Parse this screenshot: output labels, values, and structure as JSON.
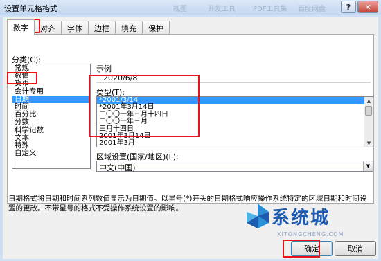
{
  "window": {
    "title": "设置单元格格式",
    "help": "?",
    "close": "✕",
    "ghost_labels": [
      "视图",
      "开发工具",
      "PDF工具集",
      "百度网盘"
    ]
  },
  "tabs": [
    {
      "label": "数字",
      "active": true
    },
    {
      "label": "对齐",
      "active": false
    },
    {
      "label": "字体",
      "active": false
    },
    {
      "label": "边框",
      "active": false
    },
    {
      "label": "填充",
      "active": false
    },
    {
      "label": "保护",
      "active": false
    }
  ],
  "category": {
    "label": "分类(C):",
    "items": [
      "常规",
      "数值",
      "货币",
      "会计专用",
      "日期",
      "时间",
      "百分比",
      "分数",
      "科学记数",
      "文本",
      "特殊",
      "自定义"
    ],
    "selected_index": 4
  },
  "sample": {
    "legend": "示例",
    "value": "2020/6/8"
  },
  "type": {
    "label": "类型(T):",
    "items": [
      "*2001/3/14",
      "*2001年3月14日",
      "二〇〇一年三月十四日",
      "二〇〇一年三月",
      "三月十四日",
      "2001年3月14日",
      "2001年3月"
    ],
    "selected_index": 0
  },
  "locale": {
    "label": "区域设置(国家/地区)(L):",
    "value": "中文(中国)"
  },
  "description": "日期格式将日期和时间系列数值显示为日期值。以星号(*)开头的日期格式响应操作系统特定的区域日期和时间设置的更改。不带星号的格式不受操作系统设置的影响。",
  "buttons": {
    "ok": "确定",
    "cancel": "取消"
  },
  "watermark": {
    "text": "系统城",
    "sub": "XITONGCHENG.COM"
  },
  "colors": {
    "selection": "#3399ff",
    "highlight": "#e8141b",
    "watermark": "#1d5ab2"
  }
}
